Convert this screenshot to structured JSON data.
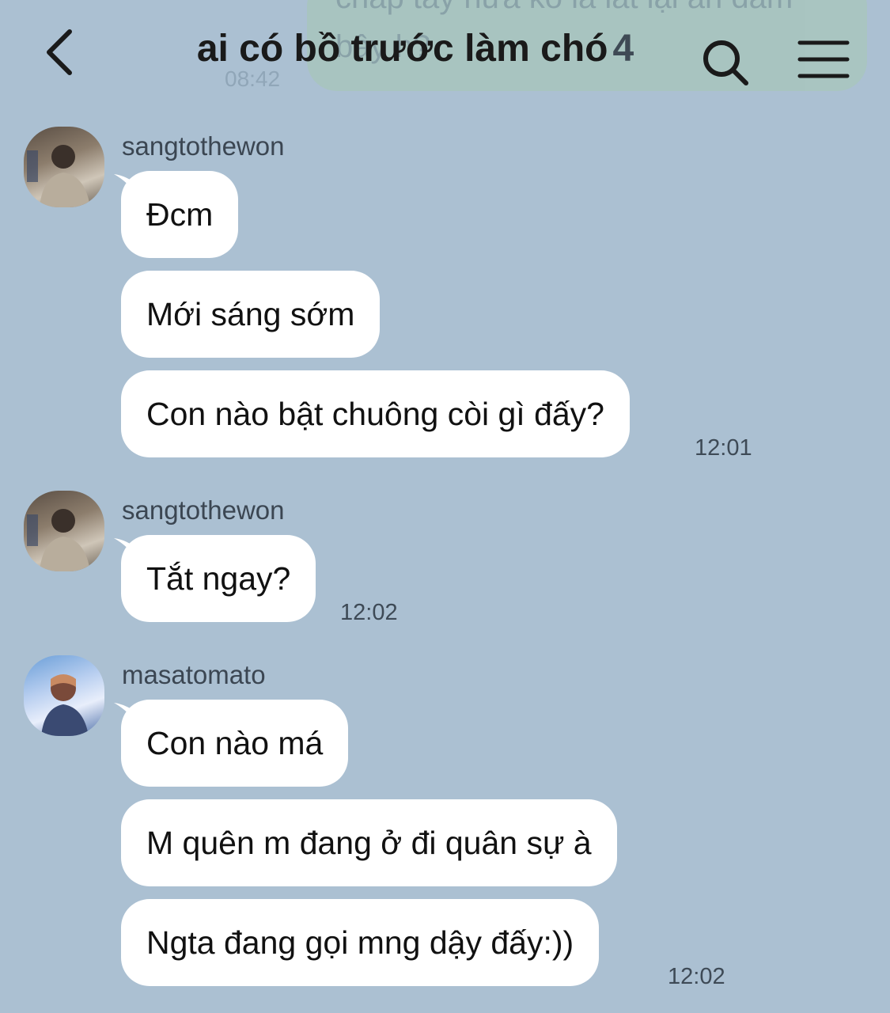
{
  "header": {
    "title": "ai có bồ trước làm chó",
    "member_count": "4",
    "back_icon": "chevron-left-icon",
    "search_icon": "search-icon",
    "menu_icon": "hamburger-menu-icon"
  },
  "background_message": {
    "text": "chắp tay nữa ko là lát lại ăn đấm bây h?",
    "time": "08:42"
  },
  "messages": [
    {
      "sender": "sangtothewon",
      "bubbles": [
        "Đcm",
        "Mới sáng sớm",
        "Con nào bật chuông còi gì đấy?"
      ],
      "time": "12:01"
    },
    {
      "sender": "sangtothewon",
      "bubbles": [
        "Tắt ngay?"
      ],
      "time": "12:02"
    },
    {
      "sender": "masatomato",
      "bubbles": [
        "Con nào má",
        "M quên m đang ở đi quân sự à",
        "Ngta đang gọi mng dậy đấy:))"
      ],
      "time": "12:02"
    }
  ],
  "colors": {
    "background": "#abc0d2",
    "bubble": "#ffffff",
    "text": "#111111",
    "meta_text": "#3e4a56"
  }
}
